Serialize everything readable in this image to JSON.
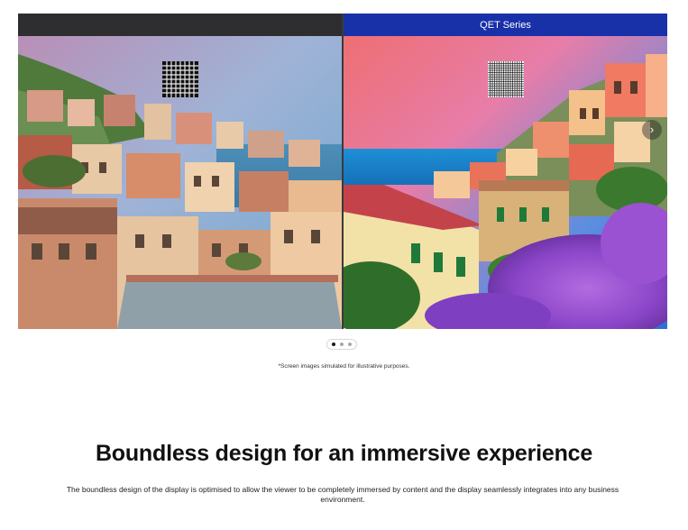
{
  "comparison": {
    "left_panel": {
      "header_label": "",
      "scene": "coastal-village-standard-display"
    },
    "right_panel": {
      "header_label": "QET Series",
      "scene": "coastal-village-qet-display"
    },
    "next_arrow_icon": "chevron-right-icon",
    "colors": {
      "left_header": "#2e2e31",
      "right_header": "#1830a8"
    }
  },
  "carousel": {
    "total_slides": 3,
    "active_slide": 1
  },
  "disclaimer": "*Screen images simulated for illustrative purposes.",
  "section": {
    "title": "Boundless design for an immersive experience",
    "description": "The boundless design of the display is optimised to allow the viewer to be completely immersed by content and the display seamlessly integrates into any business environment."
  }
}
